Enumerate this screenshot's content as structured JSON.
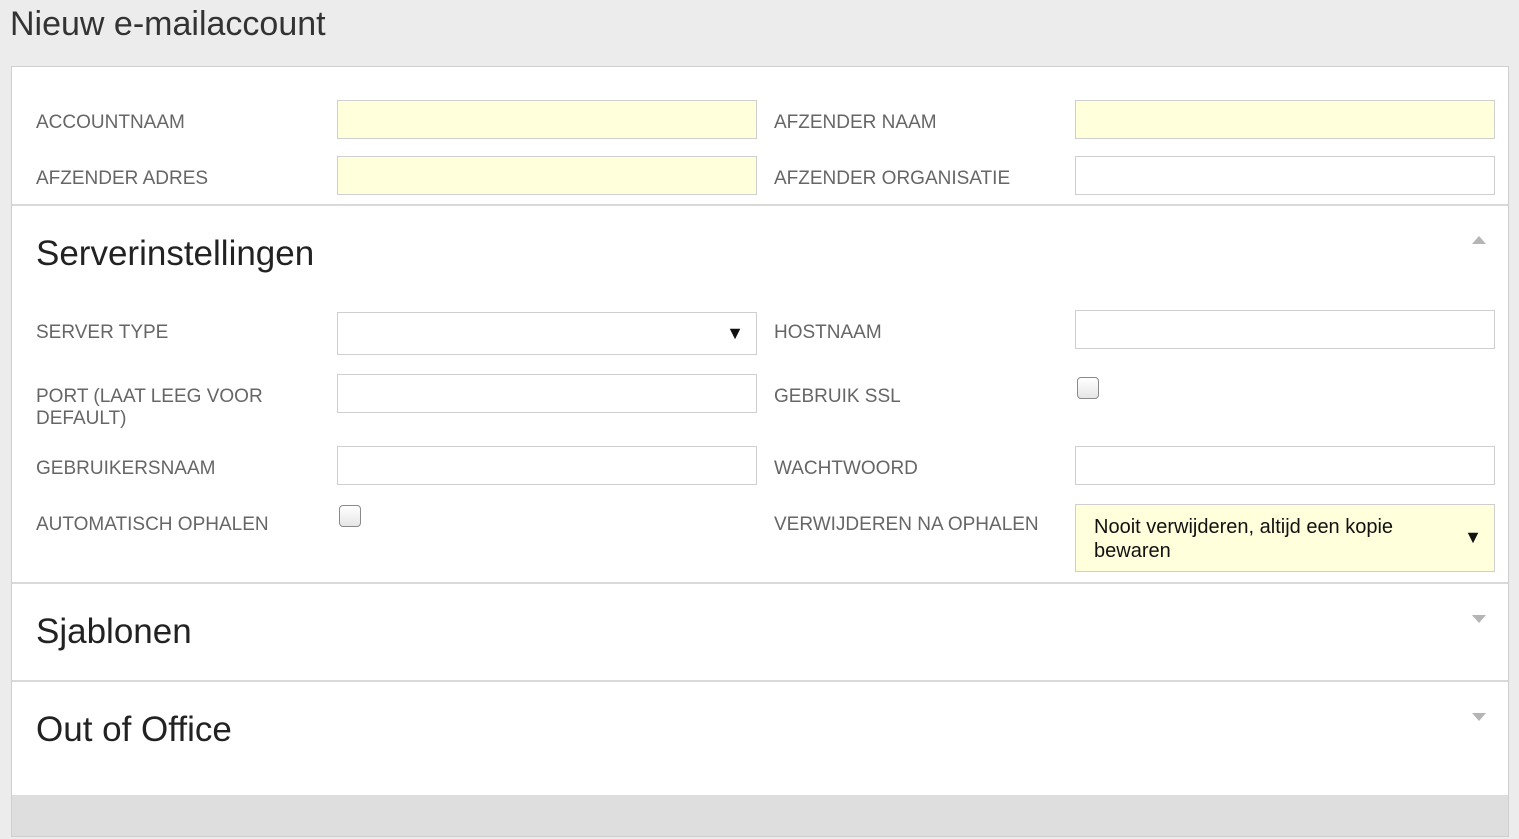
{
  "page": {
    "title": "Nieuw e-mailaccount"
  },
  "account": {
    "accountnaam_label": "ACCOUNTNAAM",
    "afzender_naam_label": "AFZENDER NAAM",
    "afzender_adres_label": "AFZENDER ADRES",
    "afzender_organisatie_label": "AFZENDER ORGANISATIE"
  },
  "server": {
    "title": "Serverinstellingen",
    "server_type_label": "SERVER TYPE",
    "server_type_value": "",
    "hostnaam_label": "HOSTNAAM",
    "port_label": "PORT (LAAT LEEG VOOR DEFAULT)",
    "ssl_label": "GEBRUIK SSL",
    "gebruikersnaam_label": "GEBRUIKERSNAAM",
    "wachtwoord_label": "WACHTWOORD",
    "auto_ophalen_label": "AUTOMATISCH OPHALEN",
    "verwijderen_label": "VERWIJDEREN NA OPHALEN",
    "verwijderen_value": "Nooit verwijderen, altijd een kopie bewaren",
    "ssl_checked": false,
    "auto_ophalen_checked": false
  },
  "sections": {
    "sjablonen": "Sjablonen",
    "out_of_office": "Out of Office"
  },
  "icons": {
    "dropdown": "▼",
    "collapse": "caret-up-icon",
    "expand": "caret-down-icon"
  },
  "colors": {
    "required_field": "#ffffdc",
    "border": "#cfcfcf",
    "background": "#ececec"
  }
}
